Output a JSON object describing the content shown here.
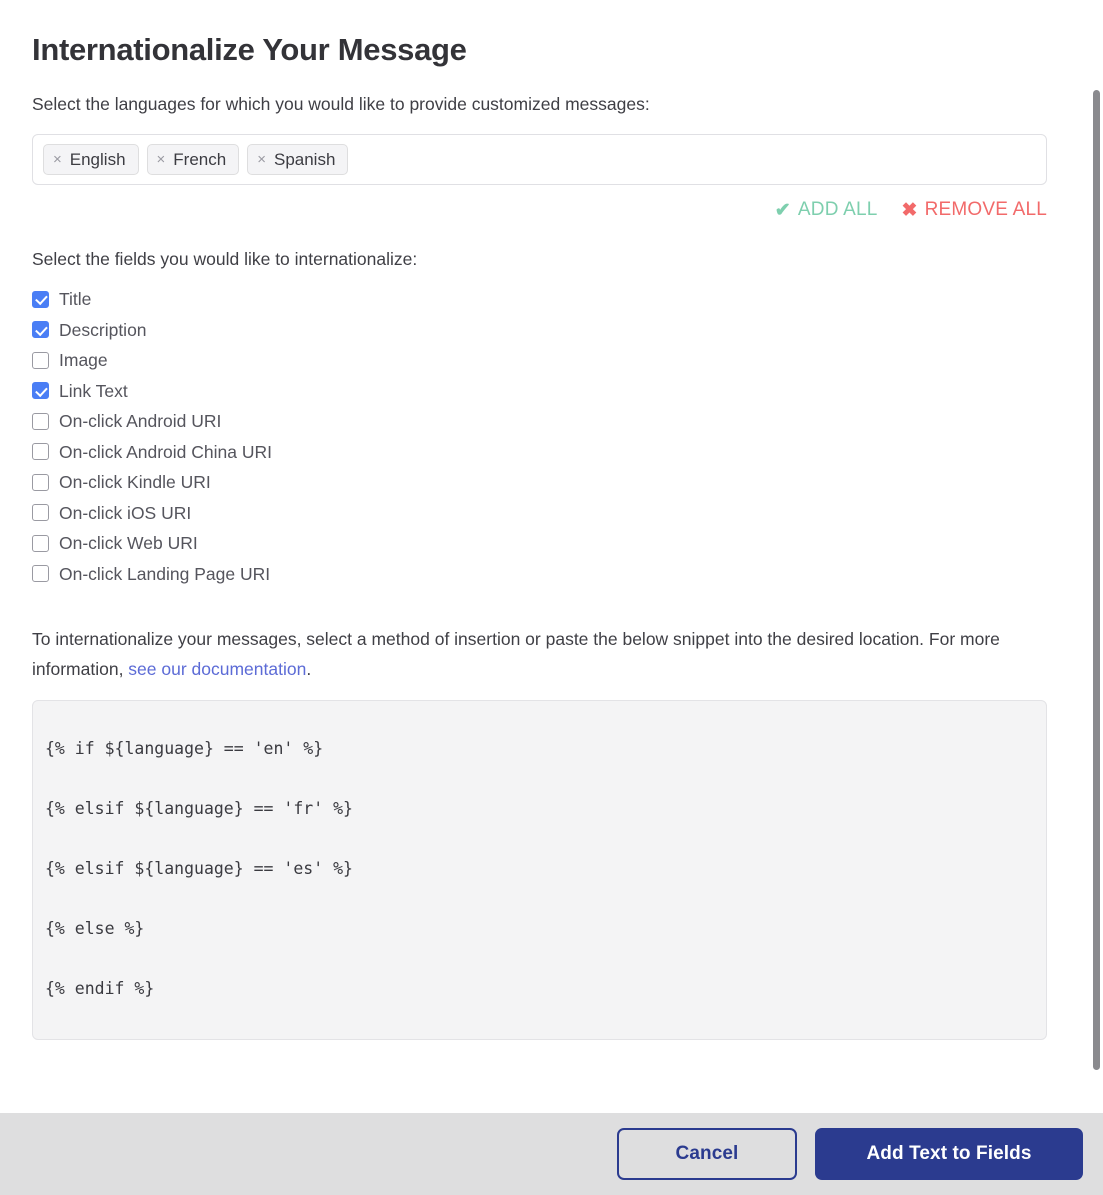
{
  "title": "Internationalize Your Message",
  "languages_label": "Select the languages for which you would like to provide customized messages:",
  "language_tokens": [
    {
      "label": "English",
      "remove_glyph": "×"
    },
    {
      "label": "French",
      "remove_glyph": "×"
    },
    {
      "label": "Spanish",
      "remove_glyph": "×"
    }
  ],
  "bulk_actions": {
    "add_all": {
      "label": "ADD ALL",
      "glyph": "✔",
      "color": "#7ecfae"
    },
    "remove_all": {
      "label": "REMOVE ALL",
      "glyph": "✖",
      "color": "#f26a6a"
    }
  },
  "fields_label": "Select the fields you would like to internationalize:",
  "fields": [
    {
      "label": "Title",
      "checked": true
    },
    {
      "label": "Description",
      "checked": true
    },
    {
      "label": "Image",
      "checked": false
    },
    {
      "label": "Link Text",
      "checked": true
    },
    {
      "label": "On-click Android URI",
      "checked": false
    },
    {
      "label": "On-click Android China URI",
      "checked": false
    },
    {
      "label": "On-click Kindle URI",
      "checked": false
    },
    {
      "label": "On-click iOS URI",
      "checked": false
    },
    {
      "label": "On-click Web URI",
      "checked": false
    },
    {
      "label": "On-click Landing Page URI",
      "checked": false
    }
  ],
  "snippet_intro": {
    "before_link": "To internationalize your messages, select a method of insertion or paste the below snippet into the desired location. For more information, ",
    "link_text": "see our documentation",
    "after_link": "."
  },
  "code_lines": [
    "{% if ${language} == 'en' %}",
    "{% elsif ${language} == 'fr' %}",
    "{% elsif ${language} == 'es' %}",
    "{% else %}",
    "{% endif %}"
  ],
  "footer": {
    "cancel_label": "Cancel",
    "submit_label": "Add Text to Fields"
  },
  "colors": {
    "accent_navy": "#2b3b8f",
    "checkbox_blue": "#4a7ef5",
    "link_blue": "#5c6bd6",
    "footer_bg": "#dededf"
  }
}
